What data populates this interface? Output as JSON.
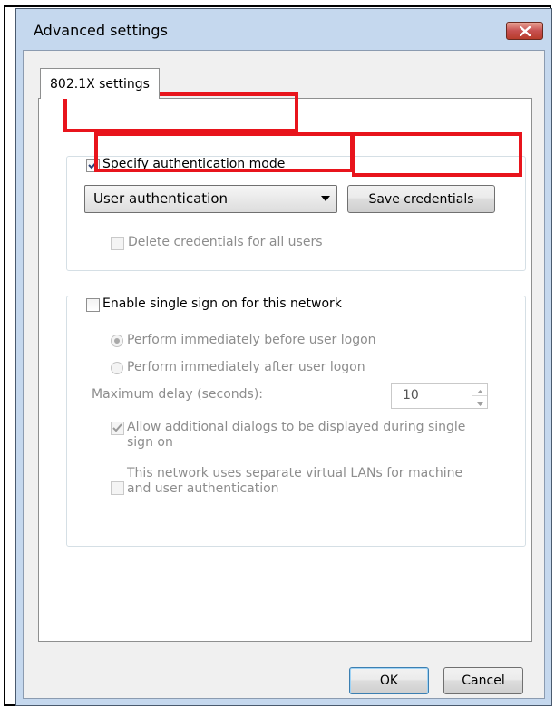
{
  "window": {
    "title": "Advanced settings"
  },
  "tabs": [
    {
      "label": "802.1X settings"
    }
  ],
  "auth": {
    "specify_label": "Specify authentication mode",
    "specify_checked": true,
    "mode_value": "User authentication",
    "save_label": "Save credentials",
    "delete_label": "Delete credentials for all users",
    "delete_checked": false
  },
  "sso": {
    "enable_label": "Enable single sign on for this network",
    "enable_checked": false,
    "radio_before_label": "Perform immediately before user logon",
    "radio_after_label": "Perform immediately after user logon",
    "selected_radio": "before",
    "max_delay_label": "Maximum delay (seconds):",
    "max_delay_value": "10",
    "allow_dialogs_label_line1": "Allow additional dialogs to be displayed during single",
    "allow_dialogs_label_line2": "sign on",
    "allow_dialogs_checked": true,
    "vlan_label_line1": "This network uses separate virtual LANs for machine",
    "vlan_label_line2": "and user authentication",
    "vlan_checked": false
  },
  "footer": {
    "ok_label": "OK",
    "cancel_label": "Cancel"
  },
  "colors": {
    "highlight": "#e8141c",
    "close_button": "#c75050",
    "window_frame": "#c5d8ee"
  },
  "icons": {
    "close": "close-icon",
    "dropdown": "chevron-down-icon",
    "spin_up": "spin-up-icon",
    "spin_down": "spin-down-icon",
    "checkmark": "checkmark-icon"
  }
}
